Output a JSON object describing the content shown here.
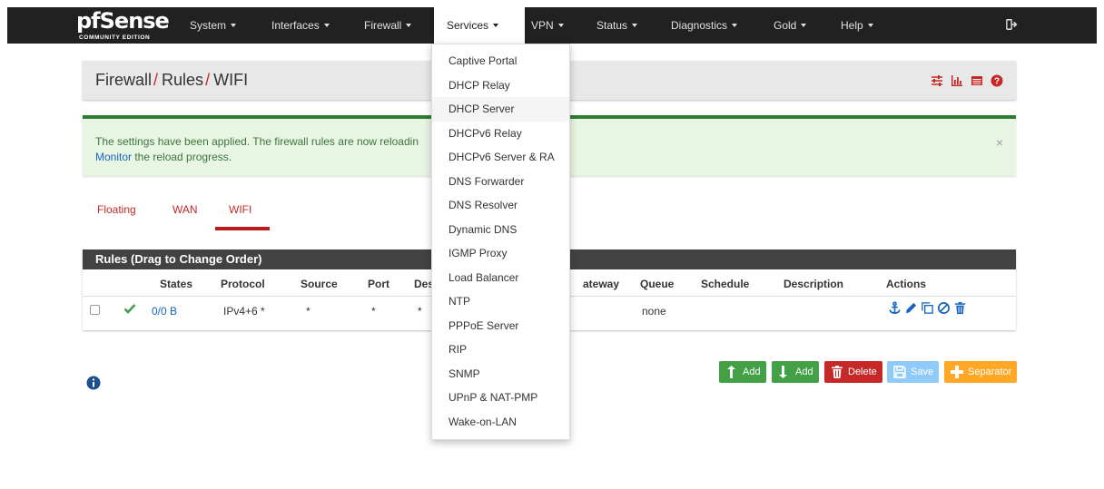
{
  "brand": {
    "logo_text": "Sense",
    "logo_glyph": "pf",
    "trademark": "",
    "edition": "COMMUNITY EDITION"
  },
  "nav": {
    "items": [
      {
        "label": "System"
      },
      {
        "label": "Interfaces"
      },
      {
        "label": "Firewall"
      },
      {
        "label": "Services"
      },
      {
        "label": "VPN"
      },
      {
        "label": "Status"
      },
      {
        "label": "Diagnostics"
      },
      {
        "label": "Gold"
      },
      {
        "label": "Help"
      }
    ],
    "active": "Services",
    "logout_icon": "logout-icon"
  },
  "breadcrumb": {
    "parts": [
      "Firewall",
      "Rules",
      "WIFI"
    ],
    "separator": "/"
  },
  "header_icons": [
    "sliders-icon",
    "bar-chart-icon",
    "table-icon",
    "help-circle-icon"
  ],
  "alert": {
    "text": "The settings have been applied. The firewall rules are now reloadin",
    "link": "Monitor",
    "text_after": " the reload progress.",
    "close": "×"
  },
  "tabs": [
    {
      "label": "Floating"
    },
    {
      "label": "WAN"
    },
    {
      "label": "WIFI"
    }
  ],
  "active_tab": "WIFI",
  "rules": {
    "title": "Rules (Drag to Change Order)",
    "columns": [
      "States",
      "Protocol",
      "Source",
      "Port",
      "Des",
      "ateway",
      "Queue",
      "Schedule",
      "Description",
      "Actions"
    ],
    "row": {
      "states": "0/0 B",
      "protocol": "IPv4+6 *",
      "source": "*",
      "port": "*",
      "destination": "*",
      "queue": "none",
      "action_icons": [
        "anchor-icon",
        "pencil-icon",
        "copy-icon",
        "block-icon",
        "trash-icon"
      ]
    }
  },
  "buttons": {
    "add_top": "Add",
    "add_bottom": "Add",
    "delete": "Delete",
    "save": "Save",
    "separator": "Separator"
  },
  "services_menu": [
    "Captive Portal",
    "DHCP Relay",
    "DHCP Server",
    "DHCPv6 Relay",
    "DHCPv6 Server & RA",
    "DNS Forwarder",
    "DNS Resolver",
    "Dynamic DNS",
    "IGMP Proxy",
    "Load Balancer",
    "NTP",
    "PPPoE Server",
    "RIP",
    "SNMP",
    "UPnP & NAT-PMP",
    "Wake-on-LAN"
  ],
  "services_menu_hover": "DHCP Server",
  "colors": {
    "navbar": "#212121",
    "accent_red": "#c62828",
    "alert_bg": "#e8f5e3",
    "alert_border": "#2e7d32",
    "link_blue": "#1565c0",
    "btn_green": "#43a047",
    "btn_red": "#c62828",
    "btn_blue": "#90caf9",
    "btn_orange": "#ffa726"
  }
}
